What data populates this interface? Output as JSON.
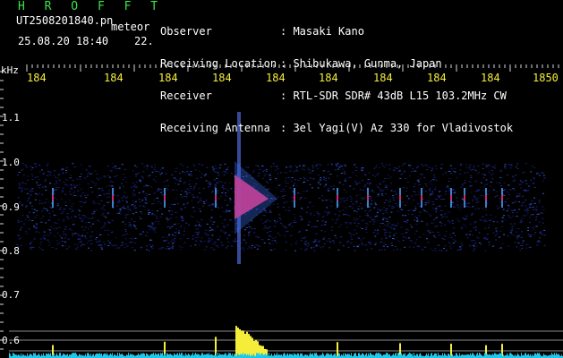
{
  "header": {
    "title": "H R O F F T",
    "filename": "UT2508201840.pn",
    "mode": "meteor",
    "datetime": "25.08.20 18:40    22.",
    "labels": [
      "Observer",
      "Receiving Location",
      "Receiver",
      "Receiving Antenna"
    ],
    "values": [
      ": Masaki Kano",
      ": Shibukawa, Gunma, Japan",
      ": RTL-SDR SDR# 43dB L15 103.2MHz CW",
      ": 3el Yagi(V) Az 330 for Vladivostok"
    ]
  },
  "axis": {
    "y_unit": "kHz",
    "y_ticks": [
      "1.1",
      "1.0",
      "0.9",
      "0.8",
      "0.7",
      "0.6"
    ],
    "x_ticks": [
      "184",
      "184",
      "184",
      "184",
      "184",
      "184",
      "184",
      "184",
      "184",
      "1850"
    ]
  },
  "colors": {
    "title": "#39e44a",
    "tick_labels": "#f4ee3a",
    "echo": "#ff2a6a",
    "noise_blue": "#2a37c8",
    "baseline": "#1ec8e8",
    "power": "#f4ee3a"
  }
}
